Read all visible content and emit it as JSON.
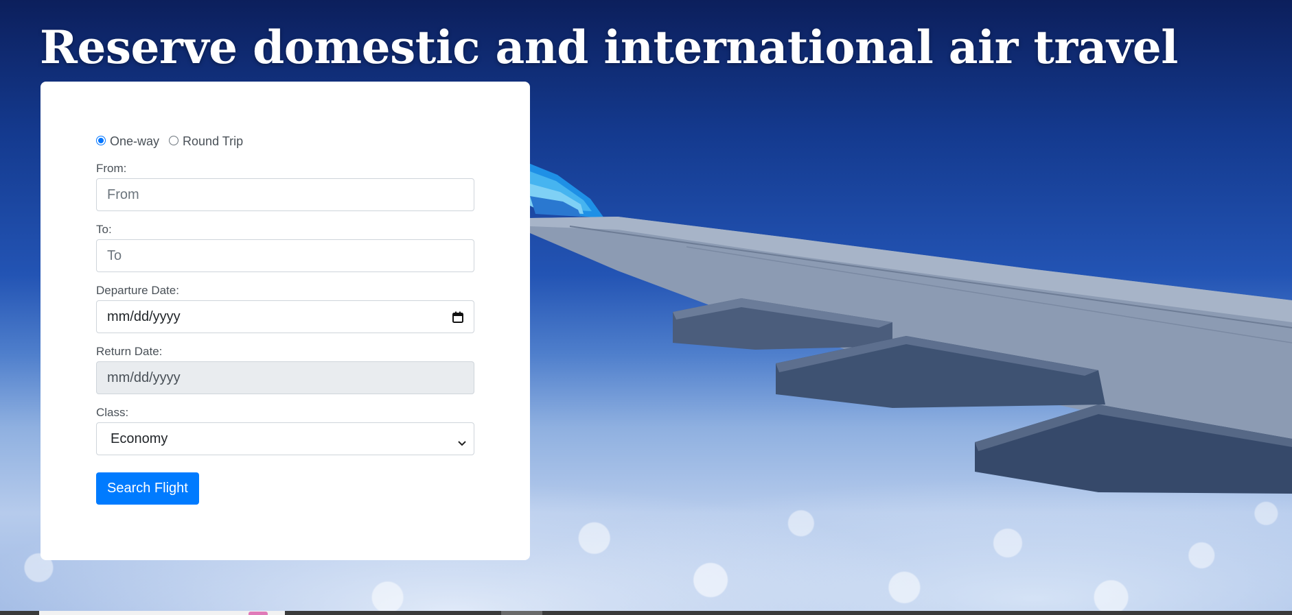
{
  "page_title": "Reserve domestic and international air travel",
  "booking_form": {
    "trip_type": {
      "options": [
        {
          "label": "One-way",
          "checked": true
        },
        {
          "label": "Round Trip",
          "checked": false
        }
      ]
    },
    "from": {
      "label": "From:",
      "placeholder": "From",
      "value": ""
    },
    "to": {
      "label": "To:",
      "placeholder": "To",
      "value": ""
    },
    "departure_date": {
      "label": "Departure Date:",
      "value": "mm/dd/yyyy"
    },
    "return_date": {
      "label": "Return Date:",
      "value": "mm/dd/yyyy",
      "disabled": true
    },
    "class": {
      "label": "Class:",
      "selected": "Economy"
    },
    "submit_label": "Search Flight"
  },
  "icons": {
    "calendar": "calendar-icon",
    "select_arrow": "chevron-down-icon"
  },
  "colors": {
    "primary": "#007bff",
    "radio_checked": "#0075ff",
    "disabled_bg": "#e9ecef",
    "sky_top": "#0c1f5c",
    "sky_bottom": "#9fb9e4"
  }
}
